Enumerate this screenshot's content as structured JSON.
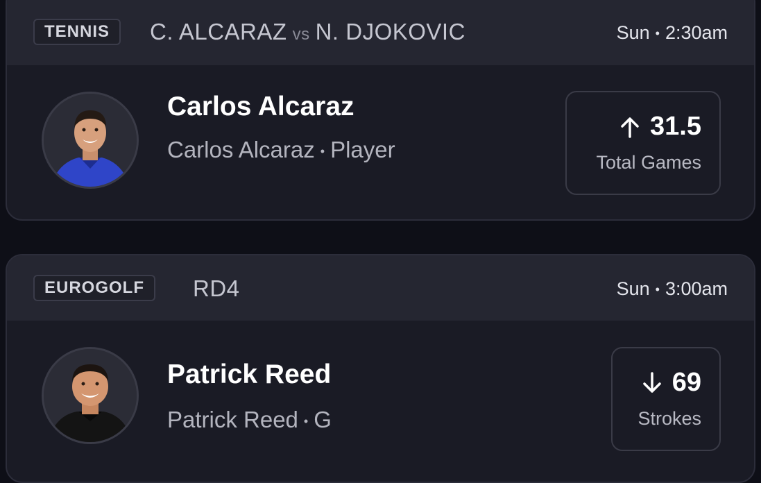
{
  "cards": [
    {
      "sport": "TENNIS",
      "matchup_home": "C. ALCARAZ",
      "matchup_vs": "vs",
      "matchup_away": "N. DJOKOVIC",
      "day": "Sun",
      "time": "2:30am",
      "player_name": "Carlos Alcaraz",
      "player_sub_name": "Carlos Alcaraz",
      "player_sub_role": "Player",
      "direction": "up",
      "line_value": "31.5",
      "line_stat": "Total Games"
    },
    {
      "sport": "EUROGOLF",
      "matchup": "RD4",
      "day": "Sun",
      "time": "3:00am",
      "player_name": "Patrick Reed",
      "player_sub_name": "Patrick Reed",
      "player_sub_role": "G",
      "direction": "down",
      "line_value": "69",
      "line_stat": "Strokes"
    }
  ],
  "separator": "•",
  "colors": {
    "background": "#0e0f17",
    "card": "#1a1b25",
    "header": "#252631",
    "border": "#2c2d3a"
  },
  "icons": {
    "up": "arrow-up-icon",
    "down": "arrow-down-icon"
  }
}
